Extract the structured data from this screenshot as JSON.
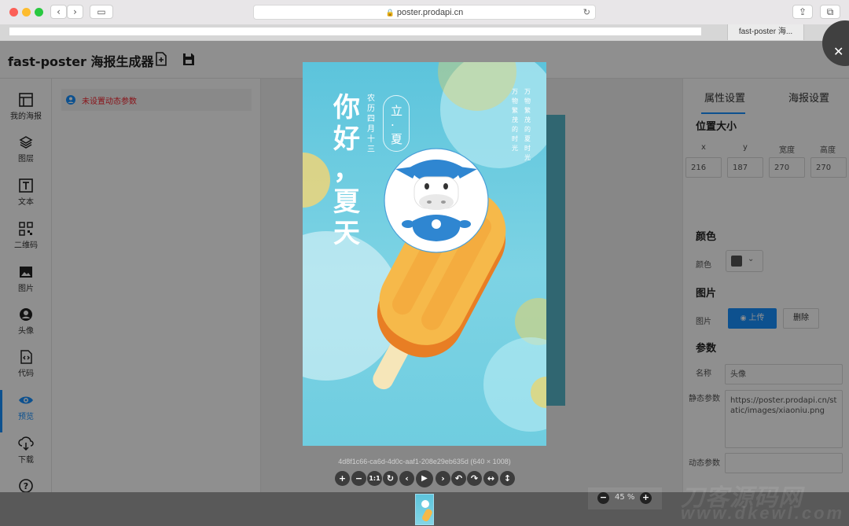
{
  "browser": {
    "url": "poster.prodapi.cn",
    "tab_title": "fast-poster 海...",
    "tab_plus": "+"
  },
  "app": {
    "title": "fast-poster 海报生成器"
  },
  "left_nav": {
    "items": [
      {
        "label": "我的海报",
        "icon": "layout-icon"
      },
      {
        "label": "图层",
        "icon": "layers-icon"
      },
      {
        "label": "文本",
        "icon": "text-icon"
      },
      {
        "label": "二维码",
        "icon": "qrcode-icon"
      },
      {
        "label": "图片",
        "icon": "image-icon"
      },
      {
        "label": "头像",
        "icon": "avatar-icon"
      },
      {
        "label": "代码",
        "icon": "code-icon"
      },
      {
        "label": "预览",
        "icon": "eye-icon"
      },
      {
        "label": "下载",
        "icon": "download-icon"
      },
      {
        "label": "帮助",
        "icon": "help-icon"
      }
    ],
    "active": "预览"
  },
  "params_panel": {
    "notice": "未设置动态参数"
  },
  "right_panel": {
    "tabs": [
      "属性设置",
      "海报设置"
    ],
    "position_section": "位置大小",
    "fields": [
      {
        "label": "x",
        "value": "216"
      },
      {
        "label": "y",
        "value": "187"
      },
      {
        "label": "宽度",
        "value": "270"
      },
      {
        "label": "高度",
        "value": "270"
      }
    ],
    "color_section": "颜色",
    "color_label": "颜色",
    "color_value": "#555555",
    "image_section": "图片",
    "image_label": "图片",
    "upload_label": "上传",
    "delete_label": "删除",
    "param_section": "参数",
    "name_label": "名称",
    "name_value": "头像",
    "static_label": "静态参数",
    "static_value": "https://poster.prodapi.cn/static/images/xiaoniu.png",
    "dynamic_label": "动态参数",
    "dynamic_value": ""
  },
  "poster": {
    "headline_chars": [
      "你",
      "好",
      "，",
      "夏",
      "天"
    ],
    "lunar_date": "农历四月十三",
    "season": "立·夏",
    "poem_col1": "万物繁茂的时光",
    "poem_col2": "万物繁茂的夏时光",
    "caption": "4d8f1c66-ca6d-4d0c-aaf1-208e29eb635d (640 × 1008)"
  },
  "toolbar": {
    "buttons": [
      "+",
      "−",
      "1:1",
      "↻",
      "‹",
      "▶",
      "›",
      "↶",
      "↷",
      "↔",
      "↕"
    ]
  },
  "zoom": {
    "level": "45 %",
    "minus": "−",
    "plus": "+"
  },
  "watermark": {
    "main": "刀客源码网",
    "sub": "www.dkewl.com"
  },
  "colors": {
    "accent": "#1890ff",
    "poster_bg": "#5cc4dc",
    "popsicle": "#f4a43a"
  }
}
